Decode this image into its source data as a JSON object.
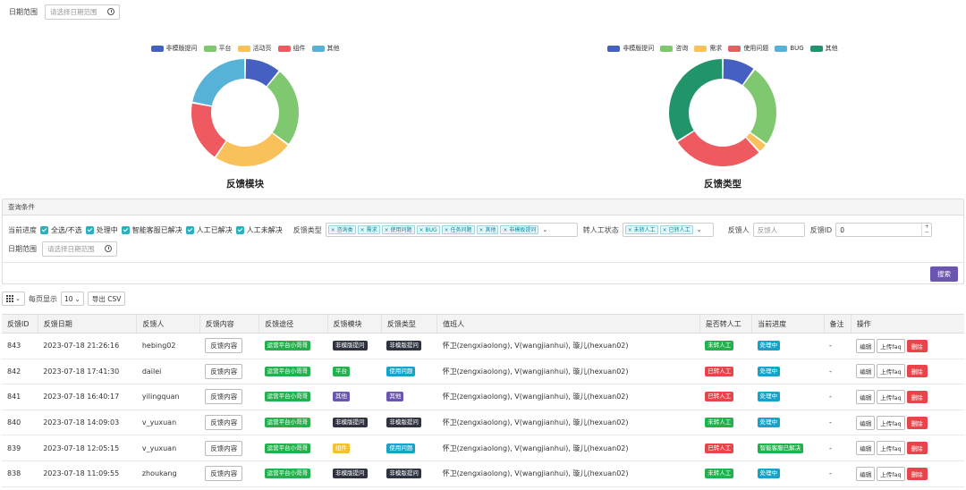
{
  "top_filter": {
    "label": "日期范围",
    "placeholder": "请选择日期范围"
  },
  "charts": [
    {
      "title": "反馈模块",
      "legend": [
        {
          "name": "非模版提问",
          "color": "#4560c0"
        },
        {
          "name": "平台",
          "color": "#80c870"
        },
        {
          "name": "活动页",
          "color": "#f9c15a"
        },
        {
          "name": "组件",
          "color": "#ef5a60"
        },
        {
          "name": "其他",
          "color": "#56b2d6"
        }
      ],
      "values": [
        10,
        22,
        22,
        17,
        20
      ]
    },
    {
      "title": "反馈类型",
      "legend": [
        {
          "name": "非模版提问",
          "color": "#4560c0"
        },
        {
          "name": "咨询",
          "color": "#80c870"
        },
        {
          "name": "需求",
          "color": "#f9c15a"
        },
        {
          "name": "使用问题",
          "color": "#ef5a60"
        },
        {
          "name": "BUG",
          "color": "#56b2d6"
        },
        {
          "name": "其他",
          "color": "#21946a"
        }
      ],
      "values": [
        10,
        25,
        3,
        28,
        0,
        34
      ]
    }
  ],
  "query": {
    "title": "查询条件",
    "progress_label": "当前进度",
    "checkboxes": [
      "全选/不选",
      "处理中",
      "智能客服已解决",
      "人工已解决",
      "人工未解决"
    ],
    "type_label": "反馈类型",
    "type_tags": [
      "咨询类",
      "需求",
      "使用问题",
      "BUG",
      "任务问题",
      "其他",
      "非模板提问"
    ],
    "manual_label": "转人工状态",
    "manual_tags": [
      "未转人工",
      "已转人工"
    ],
    "person_label": "反馈人",
    "person_placeholder": "反馈人",
    "id_label": "反馈ID",
    "id_value": "0",
    "date_label": "日期范围",
    "date_placeholder": "请选择日期范围",
    "search_button": "搜索"
  },
  "toolbar": {
    "per_page_label": "每页显示",
    "per_page_value": "10",
    "export_button": "导出 CSV"
  },
  "table": {
    "headers": [
      "反馈ID",
      "反馈日期",
      "反馈人",
      "反馈内容",
      "反馈途径",
      "反馈模块",
      "反馈类型",
      "值班人",
      "是否转人工",
      "当前进度",
      "备注",
      "操作"
    ],
    "content_button": "反馈内容",
    "ops": [
      "编辑",
      "上传faq",
      "删除"
    ],
    "rows": [
      {
        "id": "843",
        "date": "2023-07-18 21:26:16",
        "user": "hebing02",
        "channel": "运营平台小哥哥",
        "module": "非模版提问",
        "module_color": "#2f3340",
        "type": "非模版提问",
        "type_color": "#2f3340",
        "duty": "怀卫(zengxiaolong), V(wangjianhui), 璇儿(hexuan02)",
        "manual": "未转人工",
        "manual_color": "#22b14c",
        "progress": "处理中",
        "progress_color": "#17a2c8",
        "note": "-"
      },
      {
        "id": "842",
        "date": "2023-07-18 17:41:30",
        "user": "dailei",
        "channel": "运营平台小哥哥",
        "module": "平台",
        "module_color": "#22b14c",
        "type": "使用问题",
        "type_color": "#17a2c8",
        "duty": "怀卫(zengxiaolong), V(wangjianhui), 璇儿(hexuan02)",
        "manual": "已转人工",
        "manual_color": "#e8444b",
        "progress": "处理中",
        "progress_color": "#17a2c8",
        "note": "-"
      },
      {
        "id": "841",
        "date": "2023-07-18 16:40:17",
        "user": "yilingquan",
        "channel": "运营平台小哥哥",
        "module": "其他",
        "module_color": "#6a55b0",
        "type": "其他",
        "type_color": "#6a55b0",
        "duty": "怀卫(zengxiaolong), V(wangjianhui), 璇儿(hexuan02)",
        "manual": "已转人工",
        "manual_color": "#e8444b",
        "progress": "处理中",
        "progress_color": "#17a2c8",
        "note": "-"
      },
      {
        "id": "840",
        "date": "2023-07-18 14:09:03",
        "user": "v_yuxuan",
        "channel": "运营平台小哥哥",
        "module": "非模版提问",
        "module_color": "#2f3340",
        "type": "非模版提问",
        "type_color": "#2f3340",
        "duty": "怀卫(zengxiaolong), V(wangjianhui), 璇儿(hexuan02)",
        "manual": "未转人工",
        "manual_color": "#22b14c",
        "progress": "处理中",
        "progress_color": "#17a2c8",
        "note": "-"
      },
      {
        "id": "839",
        "date": "2023-07-18 12:05:15",
        "user": "v_yuxuan",
        "channel": "运营平台小哥哥",
        "module": "组件",
        "module_color": "#f2c22e",
        "type": "使用问题",
        "type_color": "#17a2c8",
        "duty": "怀卫(zengxiaolong), V(wangjianhui), 璇儿(hexuan02)",
        "manual": "已转人工",
        "manual_color": "#e8444b",
        "progress": "智能客服已解决",
        "progress_color": "#22b14c",
        "note": "-"
      },
      {
        "id": "838",
        "date": "2023-07-18 11:09:55",
        "user": "zhoukang",
        "channel": "运营平台小哥哥",
        "module": "非模版提问",
        "module_color": "#2f3340",
        "type": "非模版提问",
        "type_color": "#2f3340",
        "duty": "怀卫(zengxiaolong), V(wangjianhui), 璇儿(hexuan02)",
        "manual": "未转人工",
        "manual_color": "#22b14c",
        "progress": "处理中",
        "progress_color": "#17a2c8",
        "note": "-"
      }
    ]
  }
}
